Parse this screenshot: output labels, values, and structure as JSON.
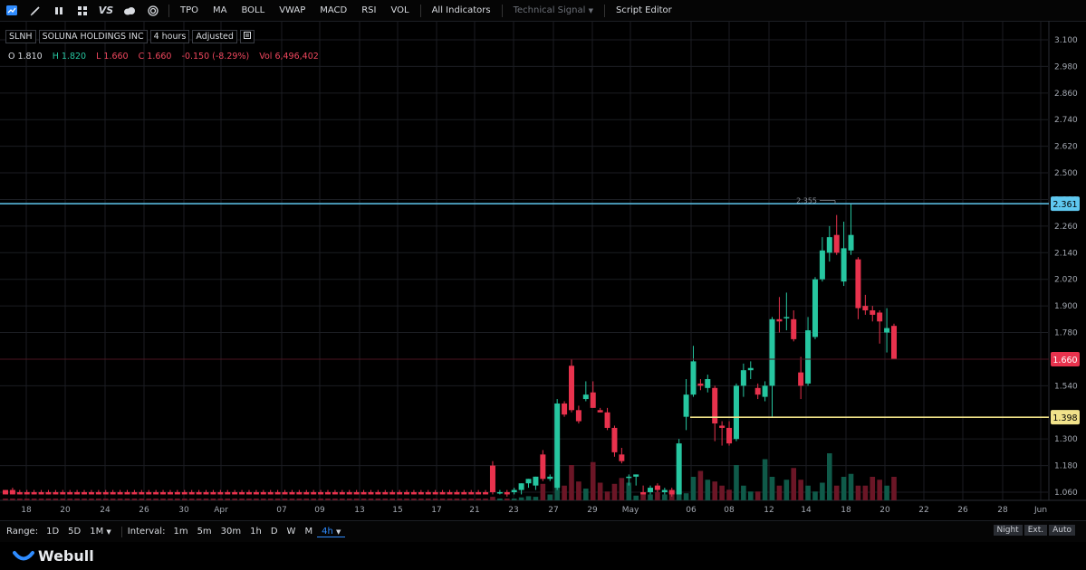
{
  "toolbar": {
    "icons": [
      "chart-style-icon",
      "draw-pencil-icon",
      "candlestick-icon",
      "layout-grid-icon",
      "vs-compare-icon",
      "cloud-icon",
      "target-icon"
    ],
    "vs_label": "VS",
    "items": [
      "TPO",
      "MA",
      "BOLL",
      "VWAP",
      "MACD",
      "RSI",
      "VOL",
      "All Indicators"
    ],
    "technical_signal": "Technical Signal",
    "script_editor": "Script Editor"
  },
  "symbol": {
    "ticker": "SLNH",
    "name": "SOLUNA HOLDINGS INC",
    "interval": "4 hours",
    "adjust": "Adjusted"
  },
  "ohlc": {
    "o_label": "O",
    "o": "1.810",
    "h_label": "H",
    "h": "1.820",
    "l_label": "L",
    "l": "1.660",
    "c_label": "C",
    "c": "1.660",
    "change": "-0.150 (-8.29%)",
    "vol_label": "Vol",
    "vol": "6,496,402"
  },
  "chart_data": {
    "type": "candlestick",
    "y_ticks": [
      "3.100",
      "2.980",
      "2.860",
      "2.740",
      "2.620",
      "2.500",
      "2.380",
      "2.260",
      "2.140",
      "2.020",
      "1.900",
      "1.780",
      "1.660",
      "1.540",
      "1.398",
      "1.300",
      "1.180",
      "1.060"
    ],
    "x_ticks": [
      "18",
      "20",
      "24",
      "26",
      "30",
      "Apr",
      "07",
      "09",
      "13",
      "15",
      "17",
      "21",
      "23",
      "27",
      "29",
      "May",
      "06",
      "08",
      "12",
      "14",
      "18",
      "20",
      "22",
      "26",
      "28",
      "Jun"
    ],
    "ylim": [
      1.02,
      3.14
    ],
    "price_lines": [
      {
        "name": "blue-horizontal-line",
        "value": 2.361,
        "label": "2.361",
        "color": "#5fc8ef"
      },
      {
        "name": "yellow-horizontal-line",
        "value": 1.398,
        "label": "1.398",
        "color": "#f1e28a"
      }
    ],
    "current_price": {
      "value": 1.66,
      "label": "1.660",
      "color": "#e8324d"
    },
    "high_marker": {
      "value": 2.355,
      "label": "2.355"
    },
    "candles": [
      {
        "o": 1.07,
        "h": 1.07,
        "l": 1.05,
        "c": 1.05
      },
      {
        "o": 1.07,
        "h": 1.08,
        "l": 1.05,
        "c": 1.05
      },
      {
        "o": 1.06,
        "h": 1.07,
        "l": 1.05,
        "c": 1.05
      },
      {
        "o": 1.06,
        "h": 1.07,
        "l": 1.05,
        "c": 1.05
      },
      {
        "o": 1.06,
        "h": 1.07,
        "l": 1.05,
        "c": 1.05
      },
      {
        "o": 1.06,
        "h": 1.07,
        "l": 1.05,
        "c": 1.05
      },
      {
        "o": 1.06,
        "h": 1.07,
        "l": 1.05,
        "c": 1.05
      },
      {
        "o": 1.06,
        "h": 1.07,
        "l": 1.05,
        "c": 1.05
      },
      {
        "o": 1.06,
        "h": 1.07,
        "l": 1.05,
        "c": 1.05
      },
      {
        "o": 1.06,
        "h": 1.07,
        "l": 1.05,
        "c": 1.05
      },
      {
        "o": 1.06,
        "h": 1.07,
        "l": 1.05,
        "c": 1.05
      },
      {
        "o": 1.06,
        "h": 1.07,
        "l": 1.05,
        "c": 1.05
      },
      {
        "o": 1.06,
        "h": 1.07,
        "l": 1.05,
        "c": 1.05
      },
      {
        "o": 1.06,
        "h": 1.07,
        "l": 1.05,
        "c": 1.05
      },
      {
        "o": 1.06,
        "h": 1.07,
        "l": 1.05,
        "c": 1.05
      },
      {
        "o": 1.06,
        "h": 1.07,
        "l": 1.05,
        "c": 1.05
      },
      {
        "o": 1.06,
        "h": 1.07,
        "l": 1.05,
        "c": 1.05
      },
      {
        "o": 1.06,
        "h": 1.07,
        "l": 1.05,
        "c": 1.05
      },
      {
        "o": 1.06,
        "h": 1.07,
        "l": 1.05,
        "c": 1.05
      },
      {
        "o": 1.06,
        "h": 1.07,
        "l": 1.05,
        "c": 1.05
      },
      {
        "o": 1.06,
        "h": 1.07,
        "l": 1.05,
        "c": 1.05
      },
      {
        "o": 1.06,
        "h": 1.07,
        "l": 1.05,
        "c": 1.05
      },
      {
        "o": 1.06,
        "h": 1.07,
        "l": 1.05,
        "c": 1.05
      },
      {
        "o": 1.06,
        "h": 1.07,
        "l": 1.05,
        "c": 1.05
      },
      {
        "o": 1.06,
        "h": 1.07,
        "l": 1.05,
        "c": 1.05
      },
      {
        "o": 1.06,
        "h": 1.07,
        "l": 1.05,
        "c": 1.05
      },
      {
        "o": 1.06,
        "h": 1.07,
        "l": 1.05,
        "c": 1.05
      },
      {
        "o": 1.06,
        "h": 1.07,
        "l": 1.05,
        "c": 1.05
      },
      {
        "o": 1.06,
        "h": 1.07,
        "l": 1.05,
        "c": 1.05
      },
      {
        "o": 1.06,
        "h": 1.07,
        "l": 1.05,
        "c": 1.05
      },
      {
        "o": 1.06,
        "h": 1.07,
        "l": 1.05,
        "c": 1.05
      },
      {
        "o": 1.06,
        "h": 1.07,
        "l": 1.05,
        "c": 1.05
      },
      {
        "o": 1.06,
        "h": 1.07,
        "l": 1.05,
        "c": 1.05
      },
      {
        "o": 1.06,
        "h": 1.07,
        "l": 1.05,
        "c": 1.05
      },
      {
        "o": 1.06,
        "h": 1.07,
        "l": 1.05,
        "c": 1.05
      },
      {
        "o": 1.06,
        "h": 1.07,
        "l": 1.05,
        "c": 1.05
      },
      {
        "o": 1.06,
        "h": 1.07,
        "l": 1.05,
        "c": 1.05
      },
      {
        "o": 1.06,
        "h": 1.07,
        "l": 1.05,
        "c": 1.05
      },
      {
        "o": 1.06,
        "h": 1.07,
        "l": 1.05,
        "c": 1.05
      },
      {
        "o": 1.06,
        "h": 1.07,
        "l": 1.05,
        "c": 1.05
      },
      {
        "o": 1.06,
        "h": 1.07,
        "l": 1.05,
        "c": 1.05
      },
      {
        "o": 1.06,
        "h": 1.07,
        "l": 1.05,
        "c": 1.05
      },
      {
        "o": 1.06,
        "h": 1.07,
        "l": 1.05,
        "c": 1.05
      },
      {
        "o": 1.06,
        "h": 1.07,
        "l": 1.05,
        "c": 1.05
      },
      {
        "o": 1.06,
        "h": 1.07,
        "l": 1.05,
        "c": 1.05
      },
      {
        "o": 1.06,
        "h": 1.07,
        "l": 1.05,
        "c": 1.05
      },
      {
        "o": 1.06,
        "h": 1.07,
        "l": 1.05,
        "c": 1.05
      },
      {
        "o": 1.06,
        "h": 1.07,
        "l": 1.05,
        "c": 1.05
      },
      {
        "o": 1.06,
        "h": 1.07,
        "l": 1.05,
        "c": 1.05
      },
      {
        "o": 1.06,
        "h": 1.07,
        "l": 1.05,
        "c": 1.05
      },
      {
        "o": 1.06,
        "h": 1.07,
        "l": 1.05,
        "c": 1.05
      },
      {
        "o": 1.06,
        "h": 1.07,
        "l": 1.05,
        "c": 1.05
      },
      {
        "o": 1.06,
        "h": 1.07,
        "l": 1.05,
        "c": 1.05
      },
      {
        "o": 1.06,
        "h": 1.07,
        "l": 1.05,
        "c": 1.05
      },
      {
        "o": 1.06,
        "h": 1.07,
        "l": 1.05,
        "c": 1.05
      },
      {
        "o": 1.06,
        "h": 1.07,
        "l": 1.05,
        "c": 1.05
      },
      {
        "o": 1.06,
        "h": 1.07,
        "l": 1.05,
        "c": 1.05
      },
      {
        "o": 1.06,
        "h": 1.07,
        "l": 1.05,
        "c": 1.05
      },
      {
        "o": 1.06,
        "h": 1.07,
        "l": 1.05,
        "c": 1.05
      },
      {
        "o": 1.06,
        "h": 1.07,
        "l": 1.05,
        "c": 1.05
      },
      {
        "o": 1.06,
        "h": 1.07,
        "l": 1.05,
        "c": 1.05
      },
      {
        "o": 1.06,
        "h": 1.07,
        "l": 1.05,
        "c": 1.05
      },
      {
        "o": 1.06,
        "h": 1.07,
        "l": 1.05,
        "c": 1.05
      },
      {
        "o": 1.06,
        "h": 1.07,
        "l": 1.05,
        "c": 1.05
      },
      {
        "o": 1.06,
        "h": 1.07,
        "l": 1.05,
        "c": 1.05
      },
      {
        "o": 1.06,
        "h": 1.07,
        "l": 1.05,
        "c": 1.05
      },
      {
        "o": 1.06,
        "h": 1.07,
        "l": 1.05,
        "c": 1.05
      },
      {
        "o": 1.06,
        "h": 1.07,
        "l": 1.05,
        "c": 1.05
      },
      {
        "o": 1.18,
        "h": 1.2,
        "l": 1.05,
        "c": 1.06
      },
      {
        "o": 1.06,
        "h": 1.07,
        "l": 1.05,
        "c": 1.06
      },
      {
        "o": 1.06,
        "h": 1.07,
        "l": 1.04,
        "c": 1.05
      },
      {
        "o": 1.06,
        "h": 1.08,
        "l": 1.05,
        "c": 1.07
      },
      {
        "o": 1.07,
        "h": 1.1,
        "l": 1.05,
        "c": 1.1
      },
      {
        "o": 1.1,
        "h": 1.12,
        "l": 1.08,
        "c": 1.12
      },
      {
        "o": 1.09,
        "h": 1.13,
        "l": 1.07,
        "c": 1.13
      },
      {
        "o": 1.23,
        "h": 1.25,
        "l": 1.11,
        "c": 1.12
      },
      {
        "o": 1.12,
        "h": 1.14,
        "l": 1.11,
        "c": 1.13
      },
      {
        "o": 1.08,
        "h": 1.48,
        "l": 1.07,
        "c": 1.46
      },
      {
        "o": 1.46,
        "h": 1.47,
        "l": 1.4,
        "c": 1.41
      },
      {
        "o": 1.63,
        "h": 1.66,
        "l": 1.42,
        "c": 1.43
      },
      {
        "o": 1.43,
        "h": 1.45,
        "l": 1.37,
        "c": 1.38
      },
      {
        "o": 1.48,
        "h": 1.56,
        "l": 1.47,
        "c": 1.5
      },
      {
        "o": 1.51,
        "h": 1.56,
        "l": 1.44,
        "c": 1.44
      },
      {
        "o": 1.43,
        "h": 1.44,
        "l": 1.42,
        "c": 1.42
      },
      {
        "o": 1.42,
        "h": 1.44,
        "l": 1.34,
        "c": 1.35
      },
      {
        "o": 1.35,
        "h": 1.36,
        "l": 1.22,
        "c": 1.24
      },
      {
        "o": 1.23,
        "h": 1.26,
        "l": 1.19,
        "c": 1.2
      },
      {
        "o": 1.13,
        "h": 1.14,
        "l": 1.09,
        "c": 1.13
      },
      {
        "o": 1.13,
        "h": 1.14,
        "l": 1.09,
        "c": 1.14
      },
      {
        "o": 1.06,
        "h": 1.09,
        "l": 1.05,
        "c": 1.05
      },
      {
        "o": 1.06,
        "h": 1.09,
        "l": 1.05,
        "c": 1.08
      },
      {
        "o": 1.09,
        "h": 1.1,
        "l": 1.06,
        "c": 1.07
      },
      {
        "o": 1.06,
        "h": 1.08,
        "l": 1.05,
        "c": 1.07
      },
      {
        "o": 1.07,
        "h": 1.08,
        "l": 1.04,
        "c": 1.05
      },
      {
        "o": 1.05,
        "h": 1.3,
        "l": 1.05,
        "c": 1.28
      },
      {
        "o": 1.4,
        "h": 1.57,
        "l": 1.34,
        "c": 1.5
      },
      {
        "o": 1.5,
        "h": 1.72,
        "l": 1.49,
        "c": 1.65
      },
      {
        "o": 1.55,
        "h": 1.57,
        "l": 1.52,
        "c": 1.54
      },
      {
        "o": 1.53,
        "h": 1.59,
        "l": 1.51,
        "c": 1.57
      },
      {
        "o": 1.53,
        "h": 1.54,
        "l": 1.29,
        "c": 1.37
      },
      {
        "o": 1.36,
        "h": 1.38,
        "l": 1.27,
        "c": 1.35
      },
      {
        "o": 1.35,
        "h": 1.38,
        "l": 1.27,
        "c": 1.28
      },
      {
        "o": 1.3,
        "h": 1.55,
        "l": 1.29,
        "c": 1.54
      },
      {
        "o": 1.54,
        "h": 1.64,
        "l": 1.49,
        "c": 1.61
      },
      {
        "o": 1.61,
        "h": 1.65,
        "l": 1.57,
        "c": 1.62
      },
      {
        "o": 1.53,
        "h": 1.55,
        "l": 1.48,
        "c": 1.5
      },
      {
        "o": 1.49,
        "h": 1.56,
        "l": 1.47,
        "c": 1.54
      },
      {
        "o": 1.54,
        "h": 1.85,
        "l": 1.4,
        "c": 1.84
      },
      {
        "o": 1.84,
        "h": 1.94,
        "l": 1.78,
        "c": 1.83
      },
      {
        "o": 1.85,
        "h": 1.96,
        "l": 1.79,
        "c": 1.85
      },
      {
        "o": 1.84,
        "h": 1.88,
        "l": 1.74,
        "c": 1.75
      },
      {
        "o": 1.6,
        "h": 1.67,
        "l": 1.48,
        "c": 1.54
      },
      {
        "o": 1.55,
        "h": 1.85,
        "l": 1.54,
        "c": 1.79
      },
      {
        "o": 1.76,
        "h": 2.03,
        "l": 1.75,
        "c": 2.02
      },
      {
        "o": 2.02,
        "h": 2.21,
        "l": 2.01,
        "c": 2.15
      },
      {
        "o": 2.14,
        "h": 2.26,
        "l": 2.1,
        "c": 2.21
      },
      {
        "o": 2.22,
        "h": 2.31,
        "l": 2.13,
        "c": 2.14
      },
      {
        "o": 2.01,
        "h": 2.28,
        "l": 1.99,
        "c": 2.16
      },
      {
        "o": 2.15,
        "h": 2.36,
        "l": 2.13,
        "c": 2.22
      },
      {
        "o": 2.11,
        "h": 2.12,
        "l": 1.84,
        "c": 1.89
      },
      {
        "o": 1.9,
        "h": 1.95,
        "l": 1.86,
        "c": 1.88
      },
      {
        "o": 1.88,
        "h": 1.9,
        "l": 1.83,
        "c": 1.86
      },
      {
        "o": 1.87,
        "h": 1.88,
        "l": 1.73,
        "c": 1.83
      },
      {
        "o": 1.78,
        "h": 1.89,
        "l": 1.69,
        "c": 1.8
      },
      {
        "o": 1.81,
        "h": 1.82,
        "l": 1.66,
        "c": 1.66
      }
    ],
    "volumes": [
      0.02,
      0.03,
      0.02,
      0.02,
      0.02,
      0.02,
      0.02,
      0.02,
      0.02,
      0.02,
      0.02,
      0.02,
      0.02,
      0.02,
      0.02,
      0.02,
      0.02,
      0.02,
      0.02,
      0.02,
      0.02,
      0.02,
      0.02,
      0.02,
      0.02,
      0.02,
      0.02,
      0.02,
      0.02,
      0.02,
      0.02,
      0.02,
      0.02,
      0.02,
      0.02,
      0.02,
      0.02,
      0.02,
      0.02,
      0.02,
      0.02,
      0.02,
      0.02,
      0.02,
      0.02,
      0.02,
      0.02,
      0.02,
      0.02,
      0.02,
      0.02,
      0.02,
      0.02,
      0.02,
      0.02,
      0.02,
      0.02,
      0.02,
      0.02,
      0.02,
      0.02,
      0.02,
      0.02,
      0.02,
      0.02,
      0.02,
      0.02,
      0.02,
      0.06,
      0.03,
      0.02,
      0.03,
      0.05,
      0.07,
      0.06,
      0.28,
      0.1,
      0.45,
      0.25,
      0.6,
      0.32,
      0.2,
      0.65,
      0.3,
      0.15,
      0.28,
      0.38,
      0.3,
      0.08,
      0.12,
      0.1,
      0.14,
      0.1,
      0.15,
      0.12,
      0.12,
      0.4,
      0.5,
      0.35,
      0.32,
      0.25,
      0.18,
      0.6,
      0.25,
      0.15,
      0.15,
      0.7,
      0.4,
      0.25,
      0.35,
      0.55,
      0.35,
      0.25,
      0.15,
      0.3,
      0.8,
      0.25,
      0.4,
      0.45,
      0.25,
      0.25,
      0.4,
      0.35,
      0.25,
      0.4,
      0.2,
      0.25,
      0.3,
      0.15,
      0.2
    ]
  },
  "bottombar": {
    "range_label": "Range:",
    "ranges": [
      "1D",
      "5D",
      "1M"
    ],
    "interval_label": "Interval:",
    "intervals": [
      "1m",
      "5m",
      "30m",
      "1h",
      "D",
      "W",
      "M",
      "4h"
    ],
    "active_interval": "4h",
    "night": "Night",
    "ext": "Ext.",
    "auto": "Auto"
  },
  "footer": {
    "logo_text": "Webull"
  },
  "colors": {
    "up": "#26c6a0",
    "down": "#e8324d",
    "grid": "#1b1d22",
    "axis_text": "#a3a8b1"
  }
}
